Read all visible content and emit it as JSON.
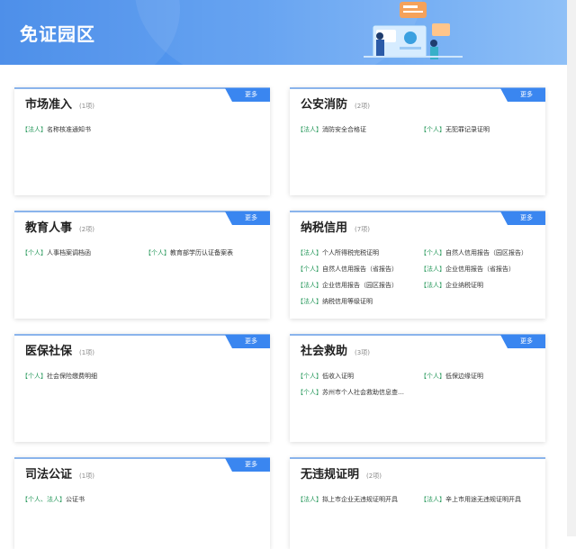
{
  "banner": {
    "title": "免证园区"
  },
  "more_label": "更多",
  "panels": [
    {
      "title": "市场准入",
      "count": "(1项)",
      "items": [
        {
          "tag": "【法人】",
          "name": "名称核准通知书"
        }
      ]
    },
    {
      "title": "公安消防",
      "count": "(2项)",
      "items": [
        {
          "tag": "【法人】",
          "name": "消防安全合格证"
        },
        {
          "tag": "【个人】",
          "name": "无犯罪记录证明"
        }
      ]
    },
    {
      "title": "教育人事",
      "count": "(2项)",
      "items": [
        {
          "tag": "【个人】",
          "name": "人事档案调档函"
        },
        {
          "tag": "【个人】",
          "name": "教育部学历认证备案表"
        }
      ]
    },
    {
      "title": "纳税信用",
      "count": "(7项)",
      "items": [
        {
          "tag": "【法人】",
          "name": "个人所得税完税证明"
        },
        {
          "tag": "【个人】",
          "name": "自然人信用报告（园区报告）"
        },
        {
          "tag": "【个人】",
          "name": "自然人信用报告（省报告）"
        },
        {
          "tag": "【法人】",
          "name": "企业信用报告（省报告）"
        },
        {
          "tag": "【法人】",
          "name": "企业信用报告（园区报告）"
        },
        {
          "tag": "【法人】",
          "name": "企业纳税证明"
        },
        {
          "tag": "【法人】",
          "name": "纳税信用等级证明"
        }
      ]
    },
    {
      "title": "医保社保",
      "count": "(1项)",
      "items": [
        {
          "tag": "【个人】",
          "name": "社会保险缴费明细"
        }
      ]
    },
    {
      "title": "社会救助",
      "count": "(3项)",
      "items": [
        {
          "tag": "【个人】",
          "name": "低收入证明"
        },
        {
          "tag": "【个人】",
          "name": "低保边缘证明"
        },
        {
          "tag": "【个人】",
          "name": "苏州市个人社会救助信息查…"
        }
      ]
    },
    {
      "title": "司法公证",
      "count": "(1项)",
      "items": [
        {
          "tag": "【个人、法人】",
          "name": "公证书"
        }
      ]
    },
    {
      "title": "无违规证明",
      "count": "(2项)",
      "items": [
        {
          "tag": "【法人】",
          "name": "拟上市企业无违规证明开具"
        },
        {
          "tag": "【法人】",
          "name": "辛上市用途无违规证明开具"
        }
      ]
    }
  ]
}
